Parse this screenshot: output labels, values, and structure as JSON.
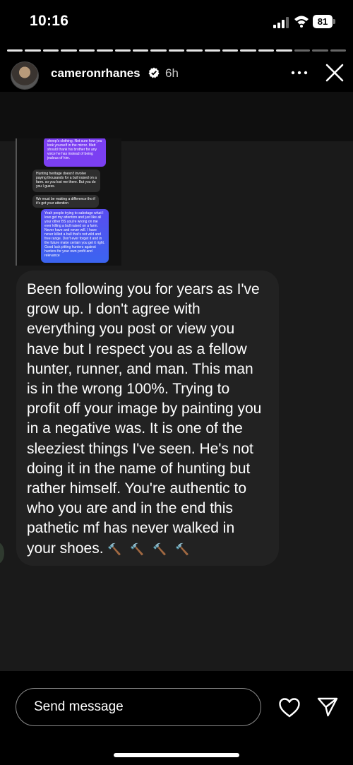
{
  "status_bar": {
    "time": "10:16",
    "battery": "81"
  },
  "story": {
    "segments_total": 19,
    "segments_viewed": 16,
    "username": "cameronrhanes",
    "time_ago": "6h",
    "verified": true
  },
  "embedded_screenshot": {
    "purple_bubble": "sheep's clothing. Not sure how you look yourself in the mirror. Matt should thank his brother for any voice he has instead of being jealous of him.",
    "gray_bubble_1": "Hunting heritage doesn't involve paying thousands for a bull raised on a farm. so you lost me there. But you do you I guess.",
    "gray_bubble_2": "We must be making a difference tho if it's got your attention",
    "blue_bubble": "Yeah people trying to sabotage what I love get my attention and just like all your other BS you're wrong on me ever killing a bull raised on a farm. Never have and never will. I have never killed a bull that's not wild and free range. Don't ever forget it and in the future make certain you get it right. Good luck pitting hunters against hunters for your own profit and relevance"
  },
  "message": {
    "text": "Been following you for years as I've grow up. I don't agree with everything you post or view you have but I respect you as a fellow hunter, runner, and man. This man is in the wrong 100%. Trying to profit off your image by painting you in a negative was. It is one of the sleeziest things I've seen. He's not doing it in the name of hunting but rather himself. You're authentic to who you are and in the end this pathetic mf has never walked in your shoes.",
    "emoji": "🔨🔨🔨🔨"
  },
  "footer": {
    "placeholder": "Send message"
  },
  "icons": [
    "signal-icon",
    "wifi-icon",
    "verified-icon",
    "more-icon",
    "close-icon",
    "heart-icon",
    "share-icon"
  ]
}
